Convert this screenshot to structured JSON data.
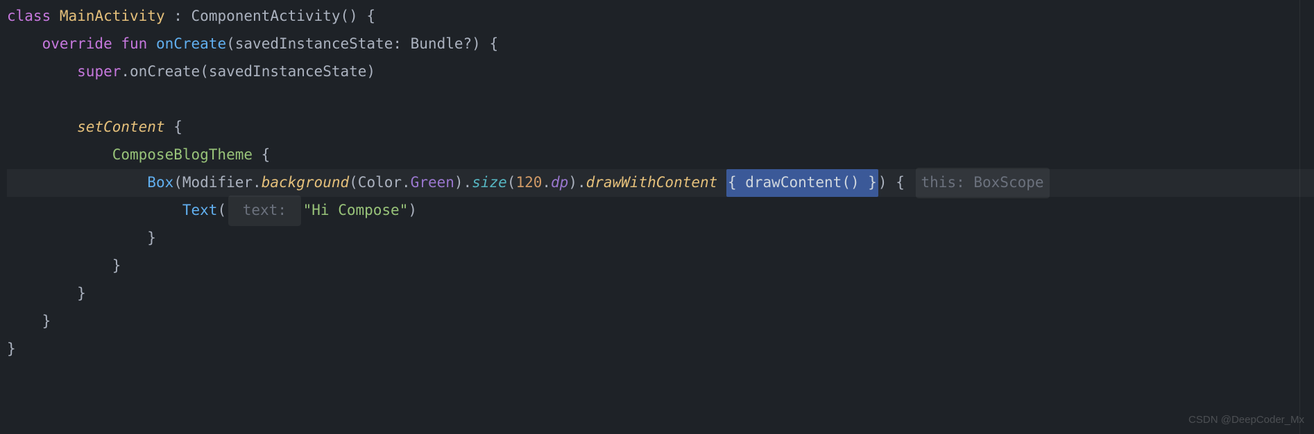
{
  "code": {
    "line1": {
      "kw_class": "class",
      "class_name": "MainActivity",
      "colon": " : ",
      "parent": "ComponentActivity",
      "parens": "()",
      "brace": " {"
    },
    "line2": {
      "indent": "    ",
      "kw_override": "override",
      "kw_fun": " fun ",
      "fn_name": "onCreate",
      "paren_open": "(",
      "param_name": "savedInstanceState",
      "colon_type": ": ",
      "type": "Bundle?",
      "paren_close": ")",
      "brace": " {"
    },
    "line3": {
      "indent": "        ",
      "super": "super",
      "dot": ".",
      "fn": "onCreate",
      "paren_open": "(",
      "arg": "savedInstanceState",
      "paren_close": ")"
    },
    "line4": {
      "indent": ""
    },
    "line5": {
      "indent": "        ",
      "setcontent": "setContent",
      "brace": " {"
    },
    "line6": {
      "indent": "            ",
      "theme": "ComposeBlogTheme",
      "brace": " {"
    },
    "line7": {
      "indent": "                ",
      "box": "Box",
      "p1": "(",
      "modifier": "Modifier",
      "dot1": ".",
      "bg": "background",
      "p2": "(",
      "color": "Color",
      "dot2": ".",
      "green": "Green",
      "p3": ")",
      "dot3": ".",
      "size": "size",
      "p4": "(",
      "num": "120",
      "dot4": ".",
      "dp": "dp",
      "p5": ")",
      "dot5": ".",
      "draw": "drawWithContent",
      "sp1": " ",
      "sel_open": "{ ",
      "sel_fn": "drawContent",
      "sel_parens": "()",
      "sel_close": " }",
      "p6": ")",
      "brace2": " { ",
      "hint": "this: BoxScope"
    },
    "line8": {
      "indent": "                    ",
      "text": "Text",
      "p1": "(",
      "hint": " text: ",
      "str": "\"Hi Compose\"",
      "p2": ")"
    },
    "line9": {
      "indent": "                ",
      "brace": "}"
    },
    "line10": {
      "indent": "            ",
      "brace": "}"
    },
    "line11": {
      "indent": "        ",
      "brace": "}"
    },
    "line12": {
      "indent": "    ",
      "brace": "}"
    },
    "line13": {
      "brace": "}"
    }
  },
  "watermark": "CSDN @DeepCoder_Mx"
}
